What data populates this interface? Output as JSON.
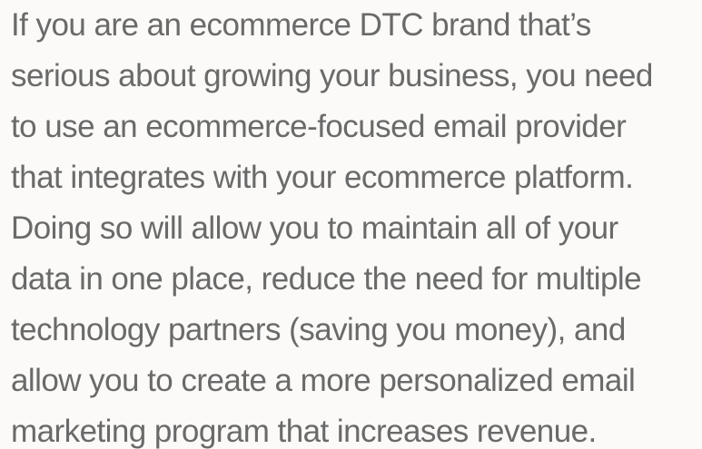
{
  "paragraph": {
    "lines": [
      "If you are an ecommerce DTC brand that’s",
      "serious about growing your business, you need",
      "to use an ecommerce-focused email provider",
      "that integrates with your ecommerce platform.",
      "Doing so will allow you to maintain all of your",
      "data in one place, reduce the need for multiple",
      "technology partners (saving you money), and",
      "allow you to create a more personalized email",
      "marketing program that increases revenue."
    ]
  },
  "colors": {
    "background": "#fbfaf8",
    "text": "#6a6a6a"
  }
}
